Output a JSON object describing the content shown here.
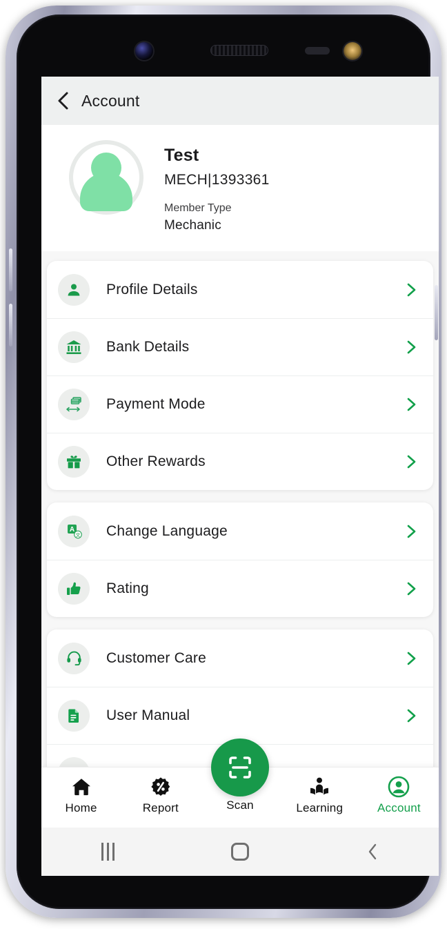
{
  "header": {
    "title": "Account",
    "back_icon": "chevron-left-icon"
  },
  "profile": {
    "avatar_icon": "user-avatar-icon",
    "name": "Test",
    "member_id": "MECH|1393361",
    "member_type_label": "Member Type",
    "member_type_value": "Mechanic"
  },
  "menu_groups": [
    {
      "items": [
        {
          "label": "Profile Details",
          "icon": "person-icon",
          "chevron": "chevron-right-icon"
        },
        {
          "label": "Bank Details",
          "icon": "bank-icon",
          "chevron": "chevron-right-icon"
        },
        {
          "label": "Payment Mode",
          "icon": "money-transfer-icon",
          "chevron": "chevron-right-icon"
        },
        {
          "label": "Other Rewards",
          "icon": "gift-icon",
          "chevron": "chevron-right-icon"
        }
      ]
    },
    {
      "items": [
        {
          "label": "Change Language",
          "icon": "translate-icon",
          "chevron": "chevron-right-icon"
        },
        {
          "label": "Rating",
          "icon": "thumbs-up-icon",
          "chevron": "chevron-right-icon"
        }
      ]
    },
    {
      "items": [
        {
          "label": "Customer Care",
          "icon": "headset-icon",
          "chevron": "chevron-right-icon"
        },
        {
          "label": "User Manual",
          "icon": "document-icon",
          "chevron": "chevron-right-icon"
        }
      ]
    }
  ],
  "bottom_nav": {
    "items": [
      {
        "label": "Home",
        "icon": "home-icon",
        "active": false
      },
      {
        "label": "Report",
        "icon": "percent-badge-icon",
        "active": false
      },
      {
        "label": "Scan",
        "icon": "scan-icon",
        "active": false
      },
      {
        "label": "Learning",
        "icon": "person-reading-icon",
        "active": false
      },
      {
        "label": "Account",
        "icon": "account-circle-icon",
        "active": true
      }
    ]
  },
  "system_bar": {
    "recents_icon": "recents-icon",
    "home_icon": "home-square-icon",
    "back_icon": "back-chevron-icon"
  },
  "colors": {
    "accent_green": "#14a04c",
    "scan_green": "#17994a",
    "avatar_green": "#7fe0a6",
    "header_bg": "#eef0f0",
    "page_bg": "#f7f7f7"
  },
  "device": {
    "camera_icon": "front-camera-icon",
    "speaker_icon": "earpiece-speaker-icon",
    "sensor_icon": "proximity-sensor-icon",
    "ir_icon": "ir-blaster-icon",
    "volume_up_button": "volume-up-button",
    "volume_down_button": "volume-down-button",
    "power_button": "power-button"
  }
}
